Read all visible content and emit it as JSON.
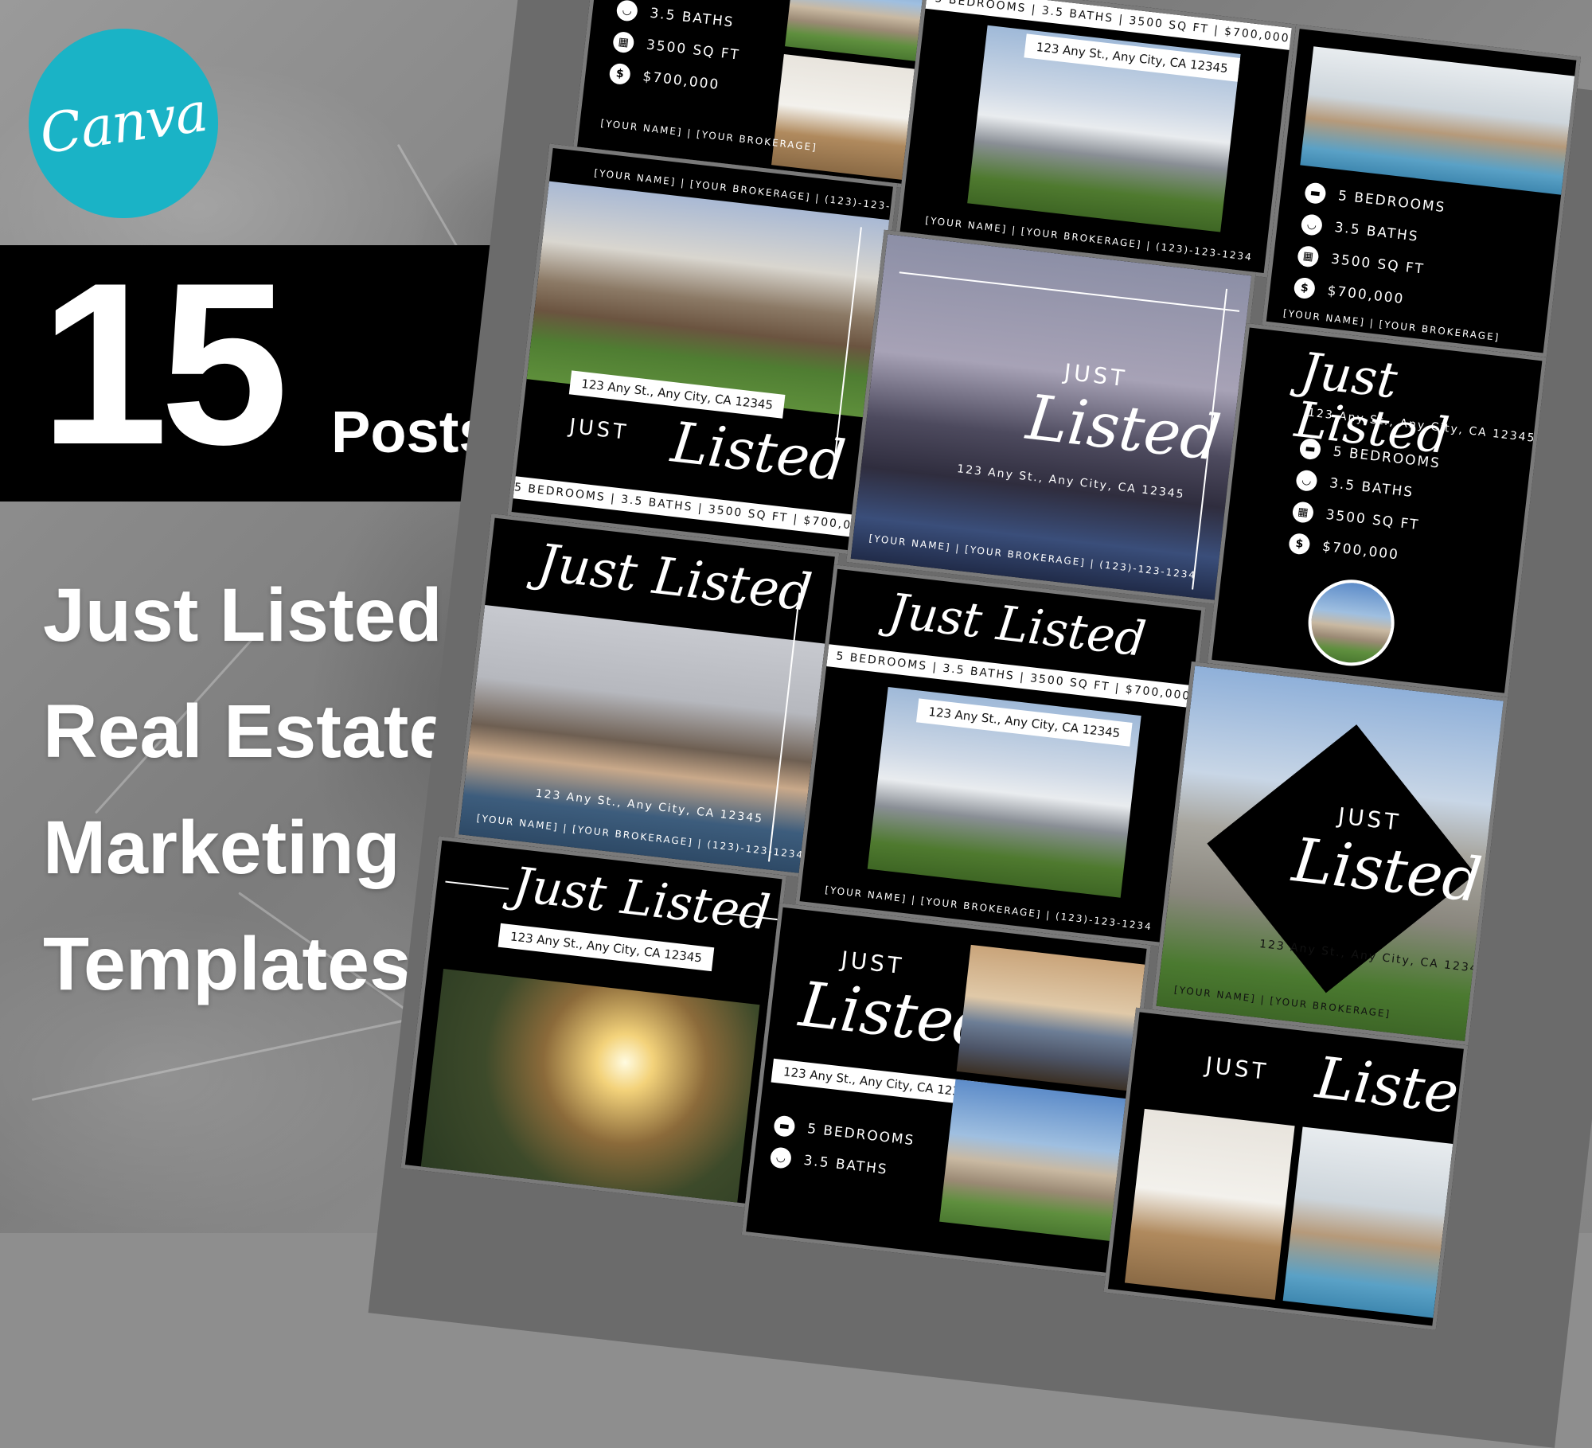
{
  "brand": {
    "name": "Canva",
    "color": "#1ab3c6"
  },
  "badge": {
    "count": "15",
    "unit": "Posts"
  },
  "headline": [
    "Just Listed",
    "Real Estate",
    "Marketing",
    "Templates"
  ],
  "listing": {
    "address": "123 Any St., Any City, CA 12345",
    "bedrooms": "5 BEDROOMS",
    "baths": "3.5 BATHS",
    "sqft": "3500 SQ FT",
    "price": "$700,000",
    "specs_line": "5 BEDROOMS | 3.5 BATHS | 3500 SQ FT | $700,000",
    "contact_line": "[YOUR NAME]  |  [YOUR BROKERAGE]  |  (123)-123-1234",
    "contact_short": "[YOUR NAME]  |  [YOUR BROKERAGE]",
    "phone": "(123)-123-1234"
  },
  "labels": {
    "just": "JUST",
    "listed_script": "Listed",
    "just_listed_script": "Just Listed"
  },
  "icons": {
    "bed": "bed-icon",
    "bath": "bath-icon",
    "area": "area-icon",
    "price": "dollar-icon"
  }
}
